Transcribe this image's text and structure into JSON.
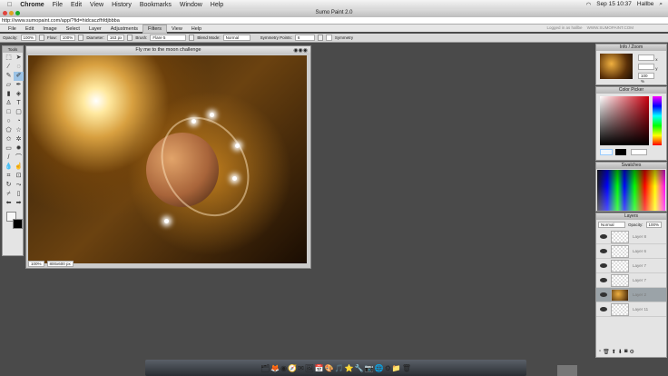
{
  "mac_menu": {
    "app": "Chrome",
    "items": [
      "File",
      "Edit",
      "View",
      "History",
      "Bookmarks",
      "Window",
      "Help"
    ],
    "clock": "Sep 15 10:37",
    "user": "Hallbe"
  },
  "window_title": "Sumo Paint 2.0",
  "url": "http://www.sumopaint.com/app/?fid=hidcaczfhfdjbbba",
  "logged_in": "Logged in as hallbe",
  "site": "WWW.SUMOPAINT.COM",
  "app_menu": [
    "File",
    "Edit",
    "Image",
    "Select",
    "Layer",
    "Adjustments",
    "Filters",
    "View",
    "Help"
  ],
  "active_menu": "Filters",
  "options": {
    "opacity_label": "Opacity:",
    "opacity": "100%",
    "flow_label": "Flow:",
    "flow": "100%",
    "diameter_label": "Diameter:",
    "diameter": "163 px",
    "brush_label": "Brush:",
    "brush": "Flare 5",
    "blend_label": "Blend Mode:",
    "blend": "Normal",
    "symmetry_points_label": "Symmetry Points:",
    "symmetry_points": "6",
    "symmetry_label": "Symmetry"
  },
  "tools": {
    "title": "Tools"
  },
  "canvas": {
    "title": "Fly me to the moon challenge",
    "zoom": "100%",
    "size": "800x600 px"
  },
  "info_panel": {
    "title": "Info / Zoom",
    "x_label": "x",
    "y_label": "y",
    "zoom": "100 %"
  },
  "color_picker": {
    "title": "Color Picker",
    "hue_color": "#cc0010"
  },
  "swatches": {
    "title": "Swatches"
  },
  "layers": {
    "title": "Layers",
    "blend": "Normal",
    "opacity_label": "Opacity:",
    "opacity": "100%",
    "items": [
      {
        "name": "Layer 8",
        "selected": false
      },
      {
        "name": "Layer 6",
        "selected": false
      },
      {
        "name": "Layer 7",
        "selected": false
      },
      {
        "name": "Layer 7",
        "selected": false
      },
      {
        "name": "Layer 2",
        "selected": true
      },
      {
        "name": "Layer 11",
        "selected": false
      }
    ]
  }
}
